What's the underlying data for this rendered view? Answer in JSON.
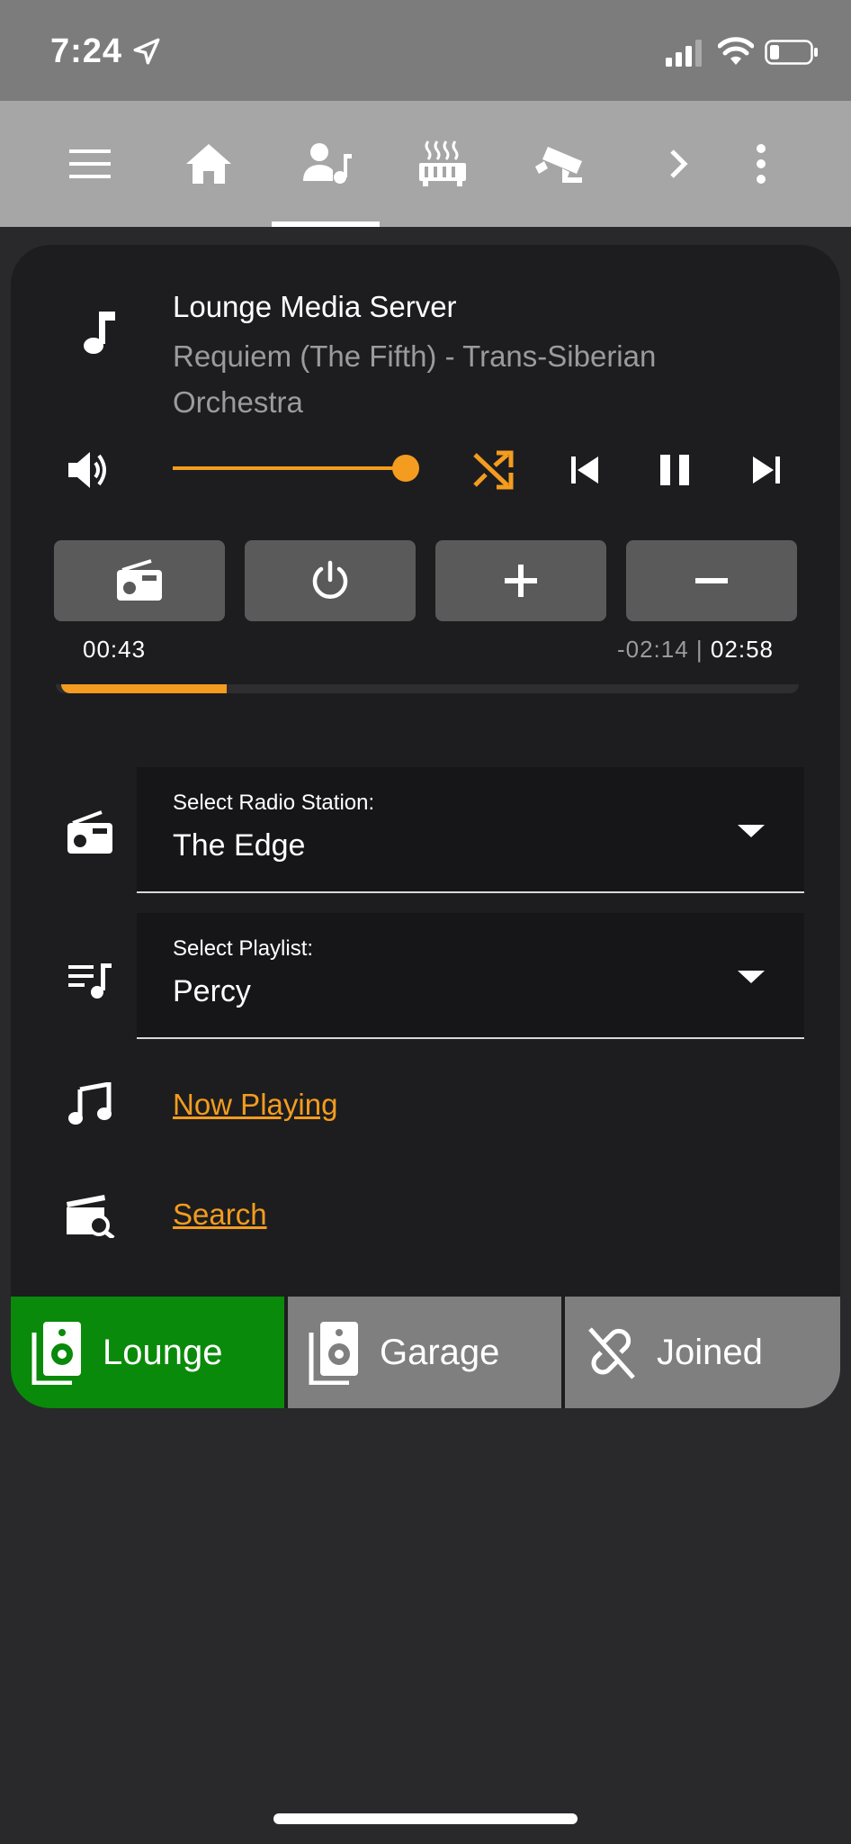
{
  "status_bar": {
    "time": "7:24"
  },
  "toolbar": {
    "tabs": [
      "menu-icon",
      "home-icon",
      "person-music-icon",
      "heater-icon",
      "cctv-icon",
      "chevron-right-icon",
      "more-vert-icon"
    ],
    "active_tab": "person-music-icon"
  },
  "media": {
    "title": "Lounge Media Server",
    "subtitle": "Requiem (The Fifth) - Trans-Siberian Orchestra",
    "volume_level": 1.0,
    "accent_color": "#f39c1f",
    "buttons": [
      "radio-icon",
      "power-icon",
      "plus-icon",
      "minus-icon"
    ],
    "elapsed": "00:43",
    "remaining": "-02:14",
    "separator": "|",
    "duration": "02:58",
    "progress": 0.24
  },
  "radio": {
    "label": "Select Radio Station:",
    "value": "The Edge"
  },
  "playlist": {
    "label": "Select Playlist:",
    "value": "Percy"
  },
  "links": {
    "now_playing": "Now Playing",
    "search": "Search"
  },
  "zones": [
    {
      "label": "Lounge",
      "color": "#0a8a0a",
      "active": true
    },
    {
      "label": "Garage",
      "color": "#7f7f7f",
      "active": false
    },
    {
      "label": "Joined",
      "color": "#7f7f7f",
      "active": false
    }
  ]
}
